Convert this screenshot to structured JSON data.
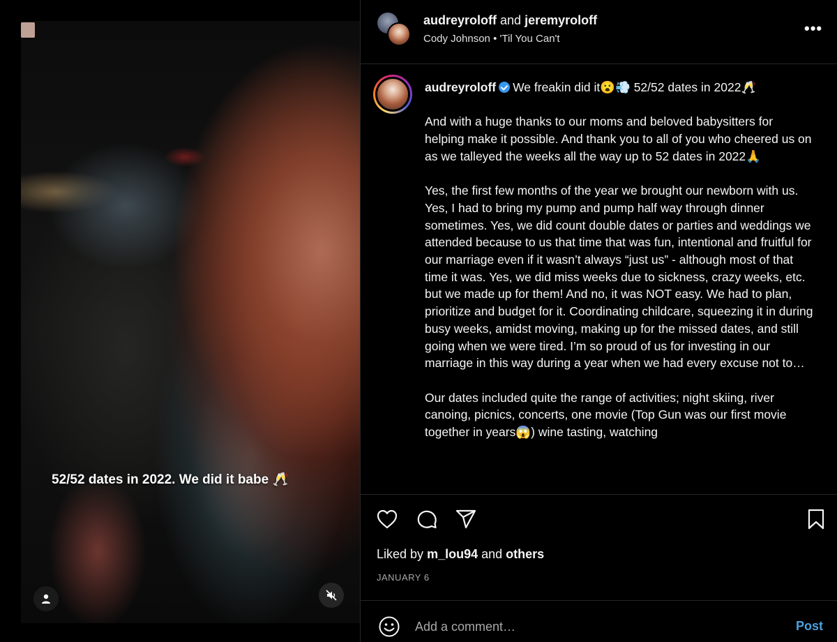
{
  "video": {
    "caption_text": "52/52 dates in 2022. We did it babe 🥂",
    "tags_icon": "user-icon",
    "mute_icon": "speaker-muted-icon"
  },
  "header": {
    "user1": "audreyroloff",
    "joiner": "and",
    "user2": "jeremyroloff",
    "audio_artist": "Cody Johnson",
    "audio_separator": "•",
    "audio_title": "'Til You Can't",
    "more_label": "•••"
  },
  "caption": {
    "username": "audreyroloff",
    "first_line": "We freakin did it😮💨 52/52 dates in 2022🥂",
    "para1": "And with a huge thanks to our moms and beloved babysitters for helping make it possible. And thank you to all of you who cheered us on as we talleyed the weeks all the way up to 52 dates in 2022🙏",
    "para2": "Yes, the first few months of the year we brought our newborn with us. Yes, I had to bring my pump and pump half way through dinner sometimes. Yes, we did count double dates or parties and weddings we attended because to us that time that was fun, intentional and fruitful for our marriage even if it wasn’t always “just us” - although most of that time it was. Yes, we did miss weeks due to sickness, crazy weeks, etc. but we made up for them! And no, it was NOT easy. We had to plan, prioritize and budget for it. Coordinating childcare, squeezing it in during busy weeks, amidst moving, making up for the missed dates, and still going when we were tired. I’m so proud of us for investing in our marriage in this way during a year when we had every excuse not to…",
    "para3": "Our dates included quite the range of activities; night skiing, river canoing, picnics, concerts, one movie (Top Gun was our first movie together in years😱) wine tasting, watching"
  },
  "actions": {
    "like_icon": "heart-icon",
    "comment_icon": "comment-icon",
    "share_icon": "send-icon",
    "save_icon": "bookmark-icon",
    "liked_by_prefix": "Liked by",
    "liked_by_user": "m_lou94",
    "liked_by_and": "and",
    "liked_by_others": "others",
    "date": "JANUARY 6"
  },
  "comment": {
    "emoji_icon": "emoji-icon",
    "placeholder": "Add a comment…",
    "post_label": "Post",
    "post_color": "#4ca0e0"
  }
}
